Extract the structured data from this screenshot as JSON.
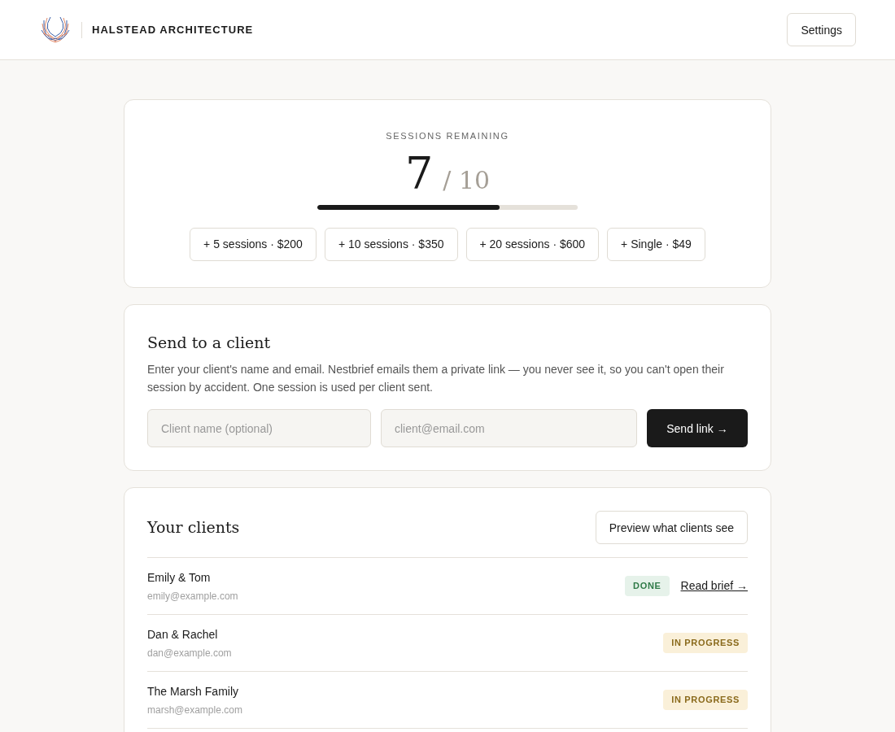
{
  "header": {
    "brand": "HALSTEAD ARCHITECTURE",
    "settings_button": "Settings"
  },
  "sessions": {
    "label": "SESSIONS REMAINING",
    "remaining": "7",
    "total": "/ 10",
    "level": 0.7,
    "packs": [
      "+ 5 sessions · $200",
      "+ 10 sessions · $350",
      "+ 20 sessions · $600",
      "+ Single · $49"
    ]
  },
  "send": {
    "title": "Send to a client",
    "description": "Enter your client's name and email. Nestbrief emails them a private link — you never see it, so you can't open their session by accident. One session is used per client sent.",
    "name_field": {
      "placeholder": "Client name (optional)"
    },
    "email_field": {
      "placeholder": "client@email.com"
    },
    "button": "Send link →"
  },
  "clients": {
    "title": "Your clients",
    "preview_button": "Preview what clients see",
    "rows": [
      {
        "name": "Emily & Tom",
        "email": "emily@example.com",
        "status": {
          "kind": "done",
          "label": "DONE"
        },
        "link": "Read brief →"
      },
      {
        "name": "Dan & Rachel",
        "email": "dan@example.com",
        "status": {
          "kind": "in_progress",
          "label": "IN PROGRESS"
        }
      },
      {
        "name": "The Marsh Family",
        "email": "marsh@example.com",
        "status": {
          "kind": "in_progress",
          "label": "IN PROGRESS"
        }
      }
    ]
  }
}
